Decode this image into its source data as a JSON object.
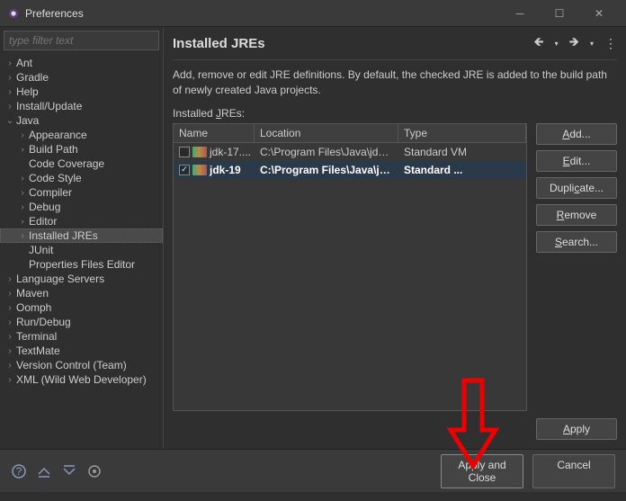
{
  "window": {
    "title": "Preferences"
  },
  "filter": {
    "placeholder": "type filter text"
  },
  "tree": [
    {
      "label": "Ant",
      "expandable": true,
      "expanded": false,
      "depth": 0
    },
    {
      "label": "Gradle",
      "expandable": true,
      "expanded": false,
      "depth": 0
    },
    {
      "label": "Help",
      "expandable": true,
      "expanded": false,
      "depth": 0
    },
    {
      "label": "Install/Update",
      "expandable": true,
      "expanded": false,
      "depth": 0
    },
    {
      "label": "Java",
      "expandable": true,
      "expanded": true,
      "depth": 0
    },
    {
      "label": "Appearance",
      "expandable": true,
      "expanded": false,
      "depth": 1
    },
    {
      "label": "Build Path",
      "expandable": true,
      "expanded": false,
      "depth": 1
    },
    {
      "label": "Code Coverage",
      "expandable": false,
      "depth": 1
    },
    {
      "label": "Code Style",
      "expandable": true,
      "expanded": false,
      "depth": 1
    },
    {
      "label": "Compiler",
      "expandable": true,
      "expanded": false,
      "depth": 1
    },
    {
      "label": "Debug",
      "expandable": true,
      "expanded": false,
      "depth": 1
    },
    {
      "label": "Editor",
      "expandable": true,
      "expanded": false,
      "depth": 1
    },
    {
      "label": "Installed JREs",
      "expandable": true,
      "expanded": false,
      "depth": 1,
      "selected": true
    },
    {
      "label": "JUnit",
      "expandable": false,
      "depth": 1
    },
    {
      "label": "Properties Files Editor",
      "expandable": false,
      "depth": 1
    },
    {
      "label": "Language Servers",
      "expandable": true,
      "expanded": false,
      "depth": 0
    },
    {
      "label": "Maven",
      "expandable": true,
      "expanded": false,
      "depth": 0
    },
    {
      "label": "Oomph",
      "expandable": true,
      "expanded": false,
      "depth": 0
    },
    {
      "label": "Run/Debug",
      "expandable": true,
      "expanded": false,
      "depth": 0
    },
    {
      "label": "Terminal",
      "expandable": true,
      "expanded": false,
      "depth": 0
    },
    {
      "label": "TextMate",
      "expandable": true,
      "expanded": false,
      "depth": 0
    },
    {
      "label": "Version Control (Team)",
      "expandable": true,
      "expanded": false,
      "depth": 0
    },
    {
      "label": "XML (Wild Web Developer)",
      "expandable": true,
      "expanded": false,
      "depth": 0
    }
  ],
  "page": {
    "title": "Installed JREs",
    "description": "Add, remove or edit JRE definitions. By default, the checked JRE is added to the build path of newly created Java projects.",
    "list_label_prefix": "Installed ",
    "list_label_mn": "J",
    "list_label_suffix": "REs:"
  },
  "table": {
    "headers": {
      "name": "Name",
      "location": "Location",
      "type": "Type"
    },
    "rows": [
      {
        "checked": false,
        "name": "jdk-17....",
        "location": "C:\\Program Files\\Java\\jdk-...",
        "type": "Standard VM",
        "default": false
      },
      {
        "checked": true,
        "name": "jdk-19",
        "location": "C:\\Program Files\\Java\\jdk...",
        "type": "Standard ...",
        "default": true
      }
    ]
  },
  "side_buttons": {
    "add": "Add...",
    "edit": "Edit...",
    "duplicate": "Duplicate...",
    "remove": "Remove",
    "search": "Search..."
  },
  "buttons": {
    "apply": "Apply",
    "apply_close": "Apply and Close",
    "cancel": "Cancel"
  }
}
